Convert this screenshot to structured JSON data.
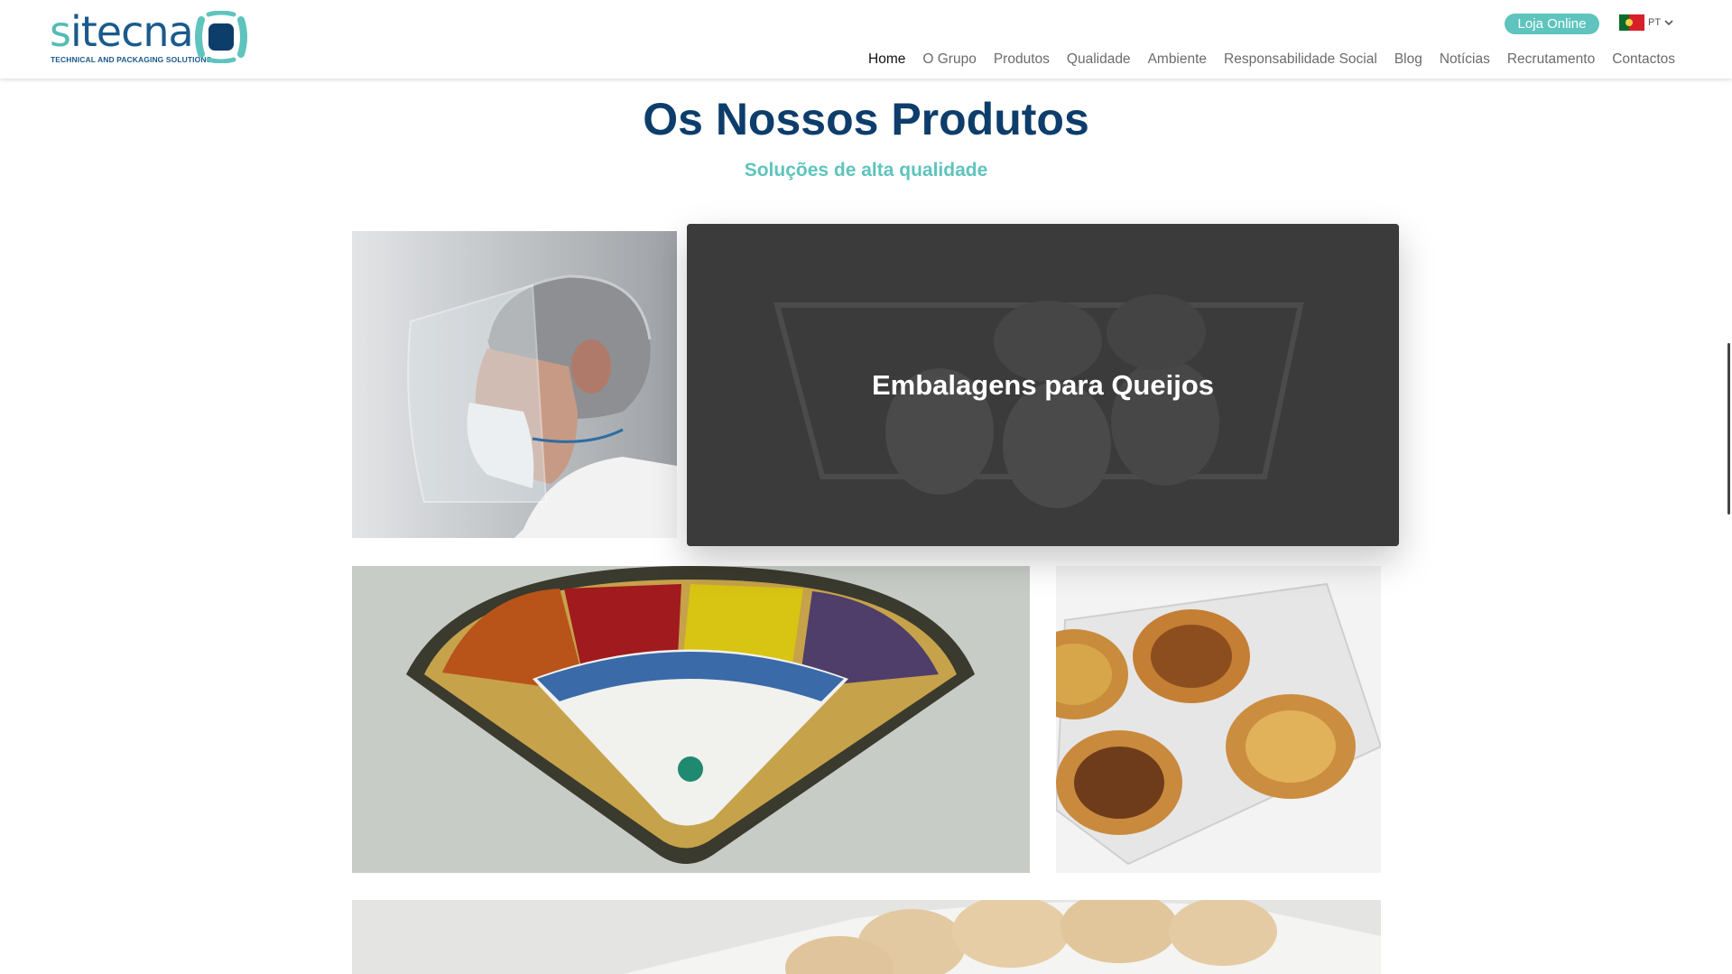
{
  "header": {
    "logo": {
      "wordmark": "sitecna",
      "tagline": "TECHNICAL AND PACKAGING SOLUTIONS"
    },
    "shop_button": "Loja Online",
    "language": {
      "code": "PT",
      "flag_icon": "portugal-flag-icon"
    },
    "nav": [
      {
        "label": "Home",
        "active": true
      },
      {
        "label": "O Grupo"
      },
      {
        "label": "Produtos"
      },
      {
        "label": "Qualidade"
      },
      {
        "label": "Ambiente"
      },
      {
        "label": "Responsabilidade Social"
      },
      {
        "label": "Blog"
      },
      {
        "label": "Notícias"
      },
      {
        "label": "Recrutamento"
      },
      {
        "label": "Contactos"
      }
    ]
  },
  "section": {
    "title": "Os Nossos Produtos",
    "subtitle": "Soluções de alta qualidade"
  },
  "products": [
    {
      "image": "face-shield-photo"
    },
    {
      "image": "cheese-packaging-photo",
      "label": "Embalagens para Queijos"
    },
    {
      "image": "sectioned-tray-photo"
    },
    {
      "image": "pastel-de-nata-clamshell-photo"
    },
    {
      "image": "bread-tray-photo"
    }
  ],
  "colors": {
    "brand_navy": "#0d3d6b",
    "brand_teal": "#5ec4bd",
    "overlay": "#3c3c3c"
  }
}
